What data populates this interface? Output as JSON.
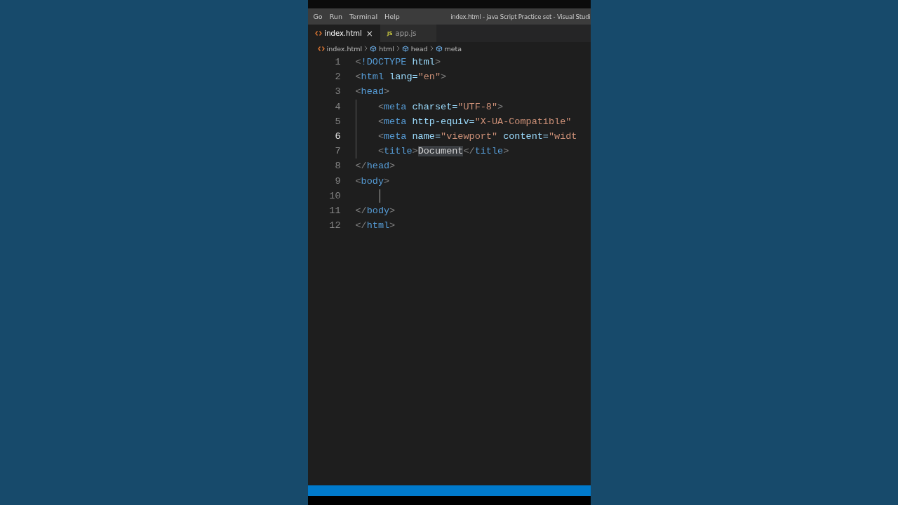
{
  "menu": [
    "Go",
    "Run",
    "Terminal",
    "Help"
  ],
  "window": {
    "title": "index.html - java Script Practice set - Visual Studi"
  },
  "tabs": [
    {
      "label": "index.html",
      "kind": "html",
      "selected": true,
      "close": "×"
    },
    {
      "label": "app.js",
      "kind": "js",
      "selected": false,
      "badge": "JS"
    }
  ],
  "breadcrumbs": [
    {
      "label": "index.html",
      "kind": "html"
    },
    {
      "label": "html",
      "kind": "symbol"
    },
    {
      "label": "head",
      "kind": "symbol"
    },
    {
      "label": "meta",
      "kind": "symbol"
    }
  ],
  "editor": {
    "lines": [
      {
        "number": "1",
        "current": false,
        "tokens": [
          {
            "t": "<",
            "kind": "punct"
          },
          {
            "t": "!DOCTYPE",
            "kind": "tag"
          },
          {
            "t": " html",
            "kind": "attr"
          },
          {
            "t": ">",
            "kind": "punct"
          }
        ]
      },
      {
        "number": "2",
        "current": false,
        "tokens": [
          {
            "t": "<",
            "kind": "punct"
          },
          {
            "t": "html",
            "kind": "tag"
          },
          {
            "t": " lang=",
            "kind": "attr"
          },
          {
            "t": "\"en\"",
            "kind": "str"
          },
          {
            "t": ">",
            "kind": "punct"
          }
        ]
      },
      {
        "number": "3",
        "current": false,
        "tokens": [
          {
            "t": "<",
            "kind": "punct"
          },
          {
            "t": "head",
            "kind": "tag"
          },
          {
            "t": ">",
            "kind": "punct"
          }
        ]
      },
      {
        "number": "4",
        "current": false,
        "guide": true,
        "tokens": [
          {
            "t": "    <",
            "kind": "punct"
          },
          {
            "t": "meta",
            "kind": "tag"
          },
          {
            "t": " charset=",
            "kind": "attr"
          },
          {
            "t": "\"UTF-8\"",
            "kind": "str"
          },
          {
            "t": ">",
            "kind": "punct"
          }
        ]
      },
      {
        "number": "5",
        "current": false,
        "guide": true,
        "tokens": [
          {
            "t": "    <",
            "kind": "punct"
          },
          {
            "t": "meta",
            "kind": "tag"
          },
          {
            "t": " http-equiv=",
            "kind": "attr"
          },
          {
            "t": "\"X-UA-Compatible\"",
            "kind": "str"
          }
        ]
      },
      {
        "number": "6",
        "current": true,
        "guide": true,
        "tokens": [
          {
            "t": "    <",
            "kind": "punct"
          },
          {
            "t": "meta",
            "kind": "tag"
          },
          {
            "t": " name=",
            "kind": "attr"
          },
          {
            "t": "\"viewport\"",
            "kind": "str"
          },
          {
            "t": " content=",
            "kind": "attr"
          },
          {
            "t": "\"widt",
            "kind": "str"
          }
        ]
      },
      {
        "number": "7",
        "current": false,
        "guide": true,
        "tokens": [
          {
            "t": "    <",
            "kind": "punct"
          },
          {
            "t": "title",
            "kind": "tag"
          },
          {
            "t": ">",
            "kind": "punct"
          },
          {
            "t": "Document",
            "kind": "text",
            "highlighted": true
          },
          {
            "t": "</",
            "kind": "punct"
          },
          {
            "t": "title",
            "kind": "tag"
          },
          {
            "t": ">",
            "kind": "punct"
          }
        ]
      },
      {
        "number": "8",
        "current": false,
        "tokens": [
          {
            "t": "</",
            "kind": "punct"
          },
          {
            "t": "head",
            "kind": "tag"
          },
          {
            "t": ">",
            "kind": "punct"
          }
        ]
      },
      {
        "number": "9",
        "current": false,
        "tokens": [
          {
            "t": "<",
            "kind": "punct"
          },
          {
            "t": "body",
            "kind": "tag"
          },
          {
            "t": ">",
            "kind": "punct"
          }
        ]
      },
      {
        "number": "10",
        "current": false,
        "cursor": true
      },
      {
        "number": "11",
        "current": false,
        "tokens": [
          {
            "t": "</",
            "kind": "punct"
          },
          {
            "t": "body",
            "kind": "tag"
          },
          {
            "t": ">",
            "kind": "punct"
          }
        ]
      },
      {
        "number": "12",
        "current": false,
        "tokens": [
          {
            "t": "</",
            "kind": "punct"
          },
          {
            "t": "html",
            "kind": "tag"
          },
          {
            "t": ">",
            "kind": "punct"
          }
        ]
      }
    ]
  }
}
